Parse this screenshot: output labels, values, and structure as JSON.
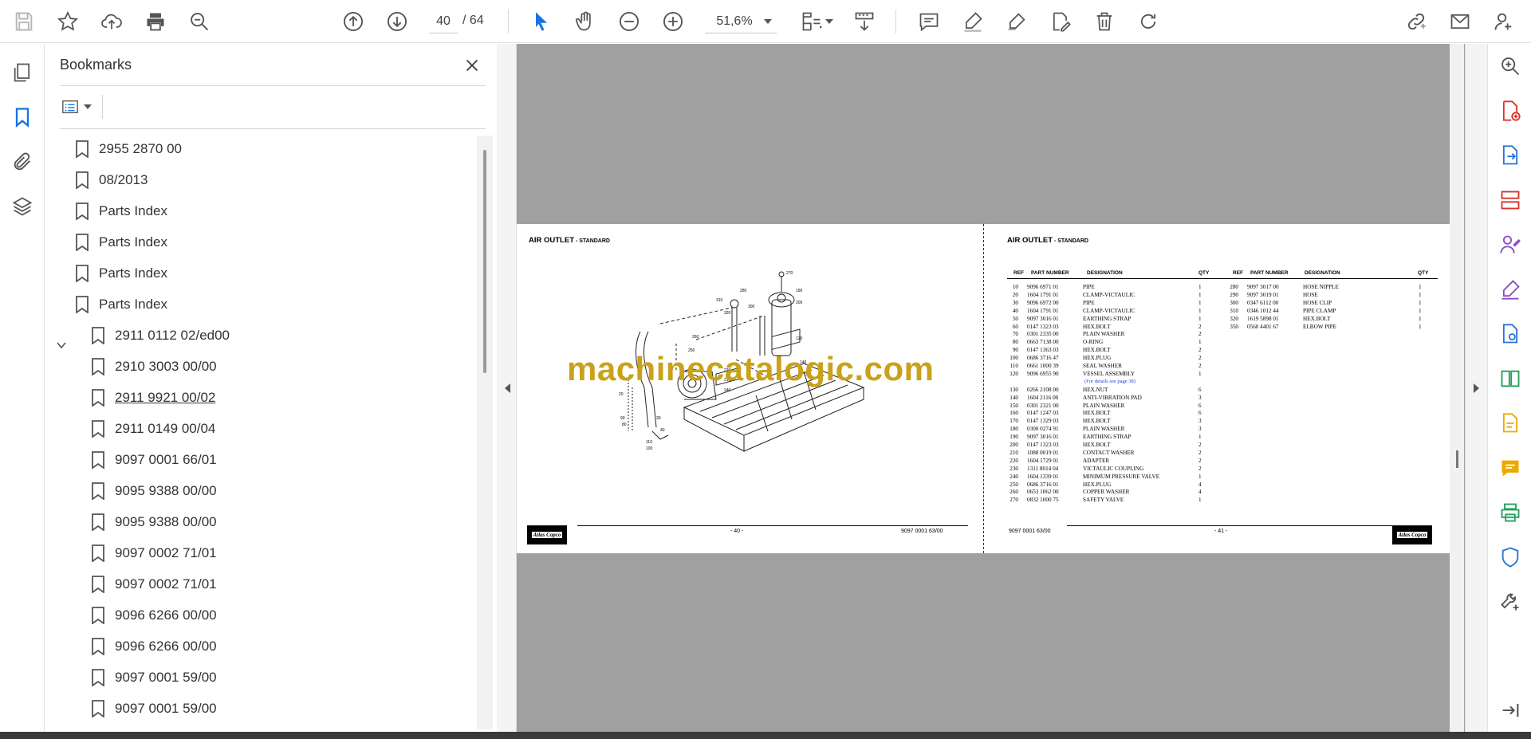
{
  "toolbar": {
    "page_current": "40",
    "page_total": "64",
    "zoom": "51,6%",
    "icons": [
      "save-icon",
      "star-icon",
      "upload-icon",
      "print-icon",
      "zoom-out-search-icon",
      "arrow-up-icon",
      "arrow-down-icon",
      "pointer-icon",
      "hand-icon",
      "minus-circle-icon",
      "plus-circle-icon",
      "fit-page-icon",
      "scroll-mode-icon",
      "comment-icon",
      "highlight-icon",
      "sign-icon",
      "edit-text-icon",
      "trash-icon",
      "rotate-icon",
      "share-link-icon",
      "mail-icon",
      "account-icon"
    ]
  },
  "bookmarks": {
    "title": "Bookmarks",
    "items": [
      {
        "label": "2955 2870 00",
        "level": 0
      },
      {
        "label": "08/2013",
        "level": 0
      },
      {
        "label": "Parts Index",
        "level": 0
      },
      {
        "label": "Parts Index",
        "level": 0
      },
      {
        "label": "Parts Index",
        "level": 0
      },
      {
        "label": "Parts Index",
        "level": 0,
        "expanded": true
      },
      {
        "label": "2911 0112 02/ed00",
        "level": 1
      },
      {
        "label": "2910 3003 00/00",
        "level": 1
      },
      {
        "label": "2911 9921 00/02",
        "level": 1,
        "underline": true
      },
      {
        "label": "2911 0149 00/04",
        "level": 1
      },
      {
        "label": "9097 0001 66/01",
        "level": 1
      },
      {
        "label": "9095 9388 00/00",
        "level": 1
      },
      {
        "label": "9095 9388 00/00",
        "level": 1
      },
      {
        "label": "9097 0002 71/01",
        "level": 1
      },
      {
        "label": "9097 0002 71/01",
        "level": 1
      },
      {
        "label": "9096 6266 00/00",
        "level": 1
      },
      {
        "label": "9096 6266 00/00",
        "level": 1
      },
      {
        "label": "9097 0001 59/00",
        "level": 1
      },
      {
        "label": "9097 0001 59/00",
        "level": 1
      }
    ]
  },
  "document": {
    "left_title": "AIR OUTLET",
    "left_subtitle": " - STANDARD",
    "right_title": "AIR OUTLET",
    "right_subtitle": " - STANDARD",
    "left_page_no": "- 40 -",
    "right_page_no": "- 41 -",
    "left_doc_code": "9097 0001 63/00",
    "right_doc_code": "9097 0001 63/00",
    "logo_text": "Atlas Copco",
    "watermark": "machinecatalogic.com",
    "table_headers": [
      "REF",
      "PART NUMBER",
      "DESIGNATION",
      "QTY"
    ],
    "parts_left": [
      [
        "10",
        "9096 6971 01",
        "PIPE",
        "1"
      ],
      [
        "20",
        "1604 1791 01",
        "CLAMP-VICTAULIC",
        "1"
      ],
      [
        "30",
        "9096 6972 00",
        "PIPE",
        "1"
      ],
      [
        "40",
        "1604 1791 01",
        "CLAMP-VICTAULIC",
        "1"
      ],
      [
        "50",
        "9097 3016 01",
        "EARTHING STRAP",
        "1"
      ],
      [
        "60",
        "0147 1323 03",
        "HEX.BOLT",
        "2"
      ],
      [
        "70",
        "0301 2335 00",
        "PLAIN WASHER",
        "2"
      ],
      [
        "80",
        "0663 7138 00",
        "O-RING",
        "1"
      ],
      [
        "90",
        "0147 1363 03",
        "HEX.BOLT",
        "2"
      ],
      [
        "100",
        "0686 3716 47",
        "HEX.PLUG",
        "2"
      ],
      [
        "110",
        "0661 1000 39",
        "SEAL WASHER",
        "2"
      ],
      [
        "120",
        "9096 6955 90",
        "VESSEL ASSEMBLY",
        "1"
      ],
      [
        "130",
        "0266 2108 00",
        "HEX.NUT",
        "6"
      ],
      [
        "140",
        "1604 2116 00",
        "ANTI-VIBRATION PAD",
        "3"
      ],
      [
        "150",
        "0301 2321 00",
        "PLAIN WASHER",
        "6"
      ],
      [
        "160",
        "0147 1247 03",
        "HEX.BOLT",
        "6"
      ],
      [
        "170",
        "0147 1329 03",
        "HEX.BOLT",
        "3"
      ],
      [
        "180",
        "0300 0274 91",
        "PLAIN WASHER",
        "3"
      ],
      [
        "190",
        "9097 3016 01",
        "EARTHING STRAP",
        "1"
      ],
      [
        "200",
        "0147 1323 03",
        "HEX.BOLT",
        "2"
      ],
      [
        "210",
        "1088 0019 01",
        "CONTACT WASHER",
        "2"
      ],
      [
        "220",
        "1604 1729 01",
        "ADAPTER",
        "2"
      ],
      [
        "230",
        "1311 8014 04",
        "VICTAULIC COUPLING",
        "2"
      ],
      [
        "240",
        "1604 1339 01",
        "MINIMUM PRESSURE VALVE",
        "1"
      ],
      [
        "250",
        "0686 3716 01",
        "HEX.PLUG",
        "4"
      ],
      [
        "260",
        "0653 1062 00",
        "COPPER WASHER",
        "4"
      ],
      [
        "270",
        "0832 1000 75",
        "SAFETY VALVE",
        "1"
      ]
    ],
    "parts_note": "(For details see page 38)",
    "parts_right": [
      [
        "280",
        "9097 3017 00",
        "HOSE NIPPLE",
        "1"
      ],
      [
        "290",
        "9097 3019 01",
        "HOSE",
        "1"
      ],
      [
        "300",
        "0347 6112 00",
        "HOSE CLIP",
        "1"
      ],
      [
        "310",
        "0346 1012 44",
        "PIPE CLAMP",
        "1"
      ],
      [
        "320",
        "1619 5898 01",
        "HEX.BOLT",
        "1"
      ],
      [
        "350",
        "0560 4401 67",
        "ELBOW PIPE",
        "1"
      ]
    ]
  },
  "colors": {
    "accent": "#1473e6",
    "doc_bg": "#a0a0a0",
    "watermark": "#c9a21a",
    "right_rail_red": "#d9342b",
    "right_rail_blue": "#2c74d6",
    "right_rail_purple": "#8b4ec6",
    "right_rail_green": "#23a15a",
    "right_rail_yellow": "#f0a800"
  }
}
